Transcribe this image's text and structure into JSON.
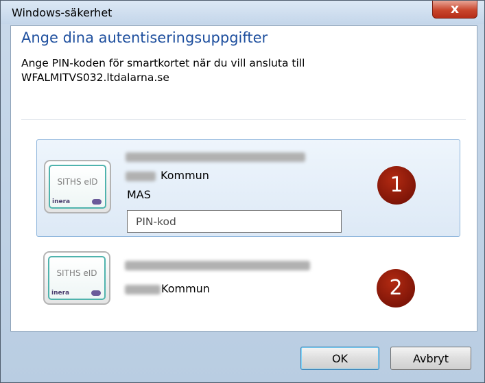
{
  "window": {
    "title": "Windows-säkerhet",
    "close_glyph": "x"
  },
  "dialog": {
    "heading": "Ange dina autentiseringsuppgifter",
    "instruction": "Ange PIN-koden för smartkortet när du vill ansluta till WFALMITVS032.ltdalarna.se"
  },
  "cards": [
    {
      "card_label": "SITHS eID",
      "card_brand": "inera",
      "org_suffix": "Kommun",
      "role": "MAS",
      "pin_placeholder": "PIN-kod",
      "badge": "1"
    },
    {
      "card_label": "SITHS eID",
      "card_brand": "inera",
      "org_suffix": "Kommun",
      "badge": "2"
    }
  ],
  "buttons": {
    "ok": "OK",
    "cancel": "Avbryt"
  },
  "colors": {
    "heading": "#1e4f9e",
    "badge": "#8b1a0b",
    "selection": "#dde9f6",
    "close": "#c9452c"
  }
}
